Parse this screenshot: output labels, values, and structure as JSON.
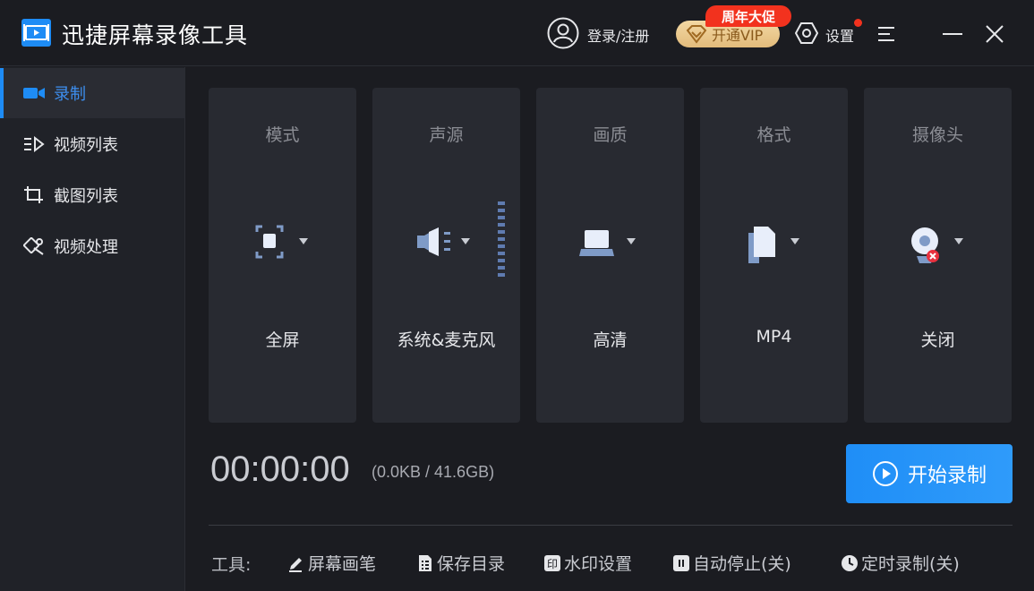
{
  "app": {
    "title": "迅捷屏幕录像工具",
    "login": "登录/注册",
    "vip": "开通VIP",
    "promo": "周年大促",
    "settings": "设置"
  },
  "sidebar": {
    "items": [
      {
        "label": "录制",
        "icon": "video-camera-icon",
        "active": true
      },
      {
        "label": "视频列表",
        "icon": "video-list-icon",
        "active": false
      },
      {
        "label": "截图列表",
        "icon": "screenshot-list-icon",
        "active": false
      },
      {
        "label": "视频处理",
        "icon": "video-edit-icon",
        "active": false
      }
    ]
  },
  "cards": [
    {
      "title": "模式",
      "value": "全屏",
      "icon": "fullscreen-mode-icon"
    },
    {
      "title": "声源",
      "value": "系统&麦克风",
      "icon": "speaker-icon"
    },
    {
      "title": "画质",
      "value": "高清",
      "icon": "monitor-icon"
    },
    {
      "title": "格式",
      "value": "MP4",
      "icon": "file-format-icon"
    },
    {
      "title": "摄像头",
      "value": "关闭",
      "icon": "webcam-off-icon"
    }
  ],
  "recording": {
    "timer": "00:00:00",
    "size_info": "(0.0KB / 41.6GB)",
    "start_label": "开始录制"
  },
  "tools": {
    "label": "工具:",
    "items": [
      {
        "label": "屏幕画笔",
        "icon": "pen-icon"
      },
      {
        "label": "保存目录",
        "icon": "folder-list-icon"
      },
      {
        "label": "水印设置",
        "icon": "watermark-icon"
      },
      {
        "label": "自动停止(关)",
        "icon": "pause-icon"
      },
      {
        "label": "定时录制(关)",
        "icon": "clock-icon"
      }
    ]
  },
  "colors": {
    "accent": "#1e8cf5",
    "background": "#1b1c21",
    "card": "#282a31",
    "promo": "#f2321e"
  }
}
